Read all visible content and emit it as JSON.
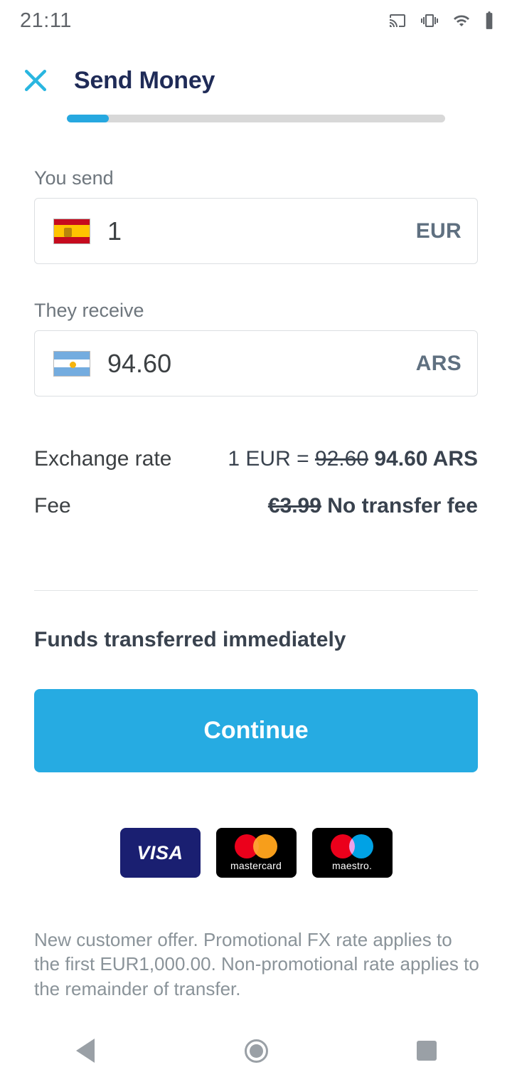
{
  "status_bar": {
    "time": "21:11",
    "icons": [
      "cast-icon",
      "vibrate-icon",
      "wifi-icon",
      "battery-icon"
    ]
  },
  "header": {
    "close_icon": "close-icon",
    "title": "Send Money",
    "progress_percent": 11
  },
  "send_field": {
    "label": "You send",
    "flag": "spain-flag-icon",
    "value": "1",
    "currency": "EUR"
  },
  "receive_field": {
    "label": "They receive",
    "flag": "argentina-flag-icon",
    "value": "94.60",
    "currency": "ARS"
  },
  "summary": {
    "exchange_rate": {
      "label": "Exchange rate",
      "prefix": "1 EUR = ",
      "old_value": "92.60",
      "new_value": "94.60 ARS"
    },
    "fee": {
      "label": "Fee",
      "old_value": "€3.99",
      "new_value": "No transfer fee"
    }
  },
  "delivery_note": "Funds transferred immediately",
  "cta": {
    "label": "Continue",
    "color": "#26abe2"
  },
  "payment_methods": [
    {
      "name": "visa",
      "label": "VISA"
    },
    {
      "name": "mastercard",
      "label": "mastercard"
    },
    {
      "name": "maestro",
      "label": "maestro."
    }
  ],
  "disclaimer": "New customer offer. Promotional FX rate applies to the first EUR1,000.00. Non-promotional rate applies to the remainder of transfer.",
  "nav_bar": {
    "back": "back-icon",
    "home": "home-icon",
    "recents": "recents-icon"
  },
  "colors": {
    "accent": "#26abe2",
    "title": "#1f2b57",
    "muted": "#6e767d"
  }
}
